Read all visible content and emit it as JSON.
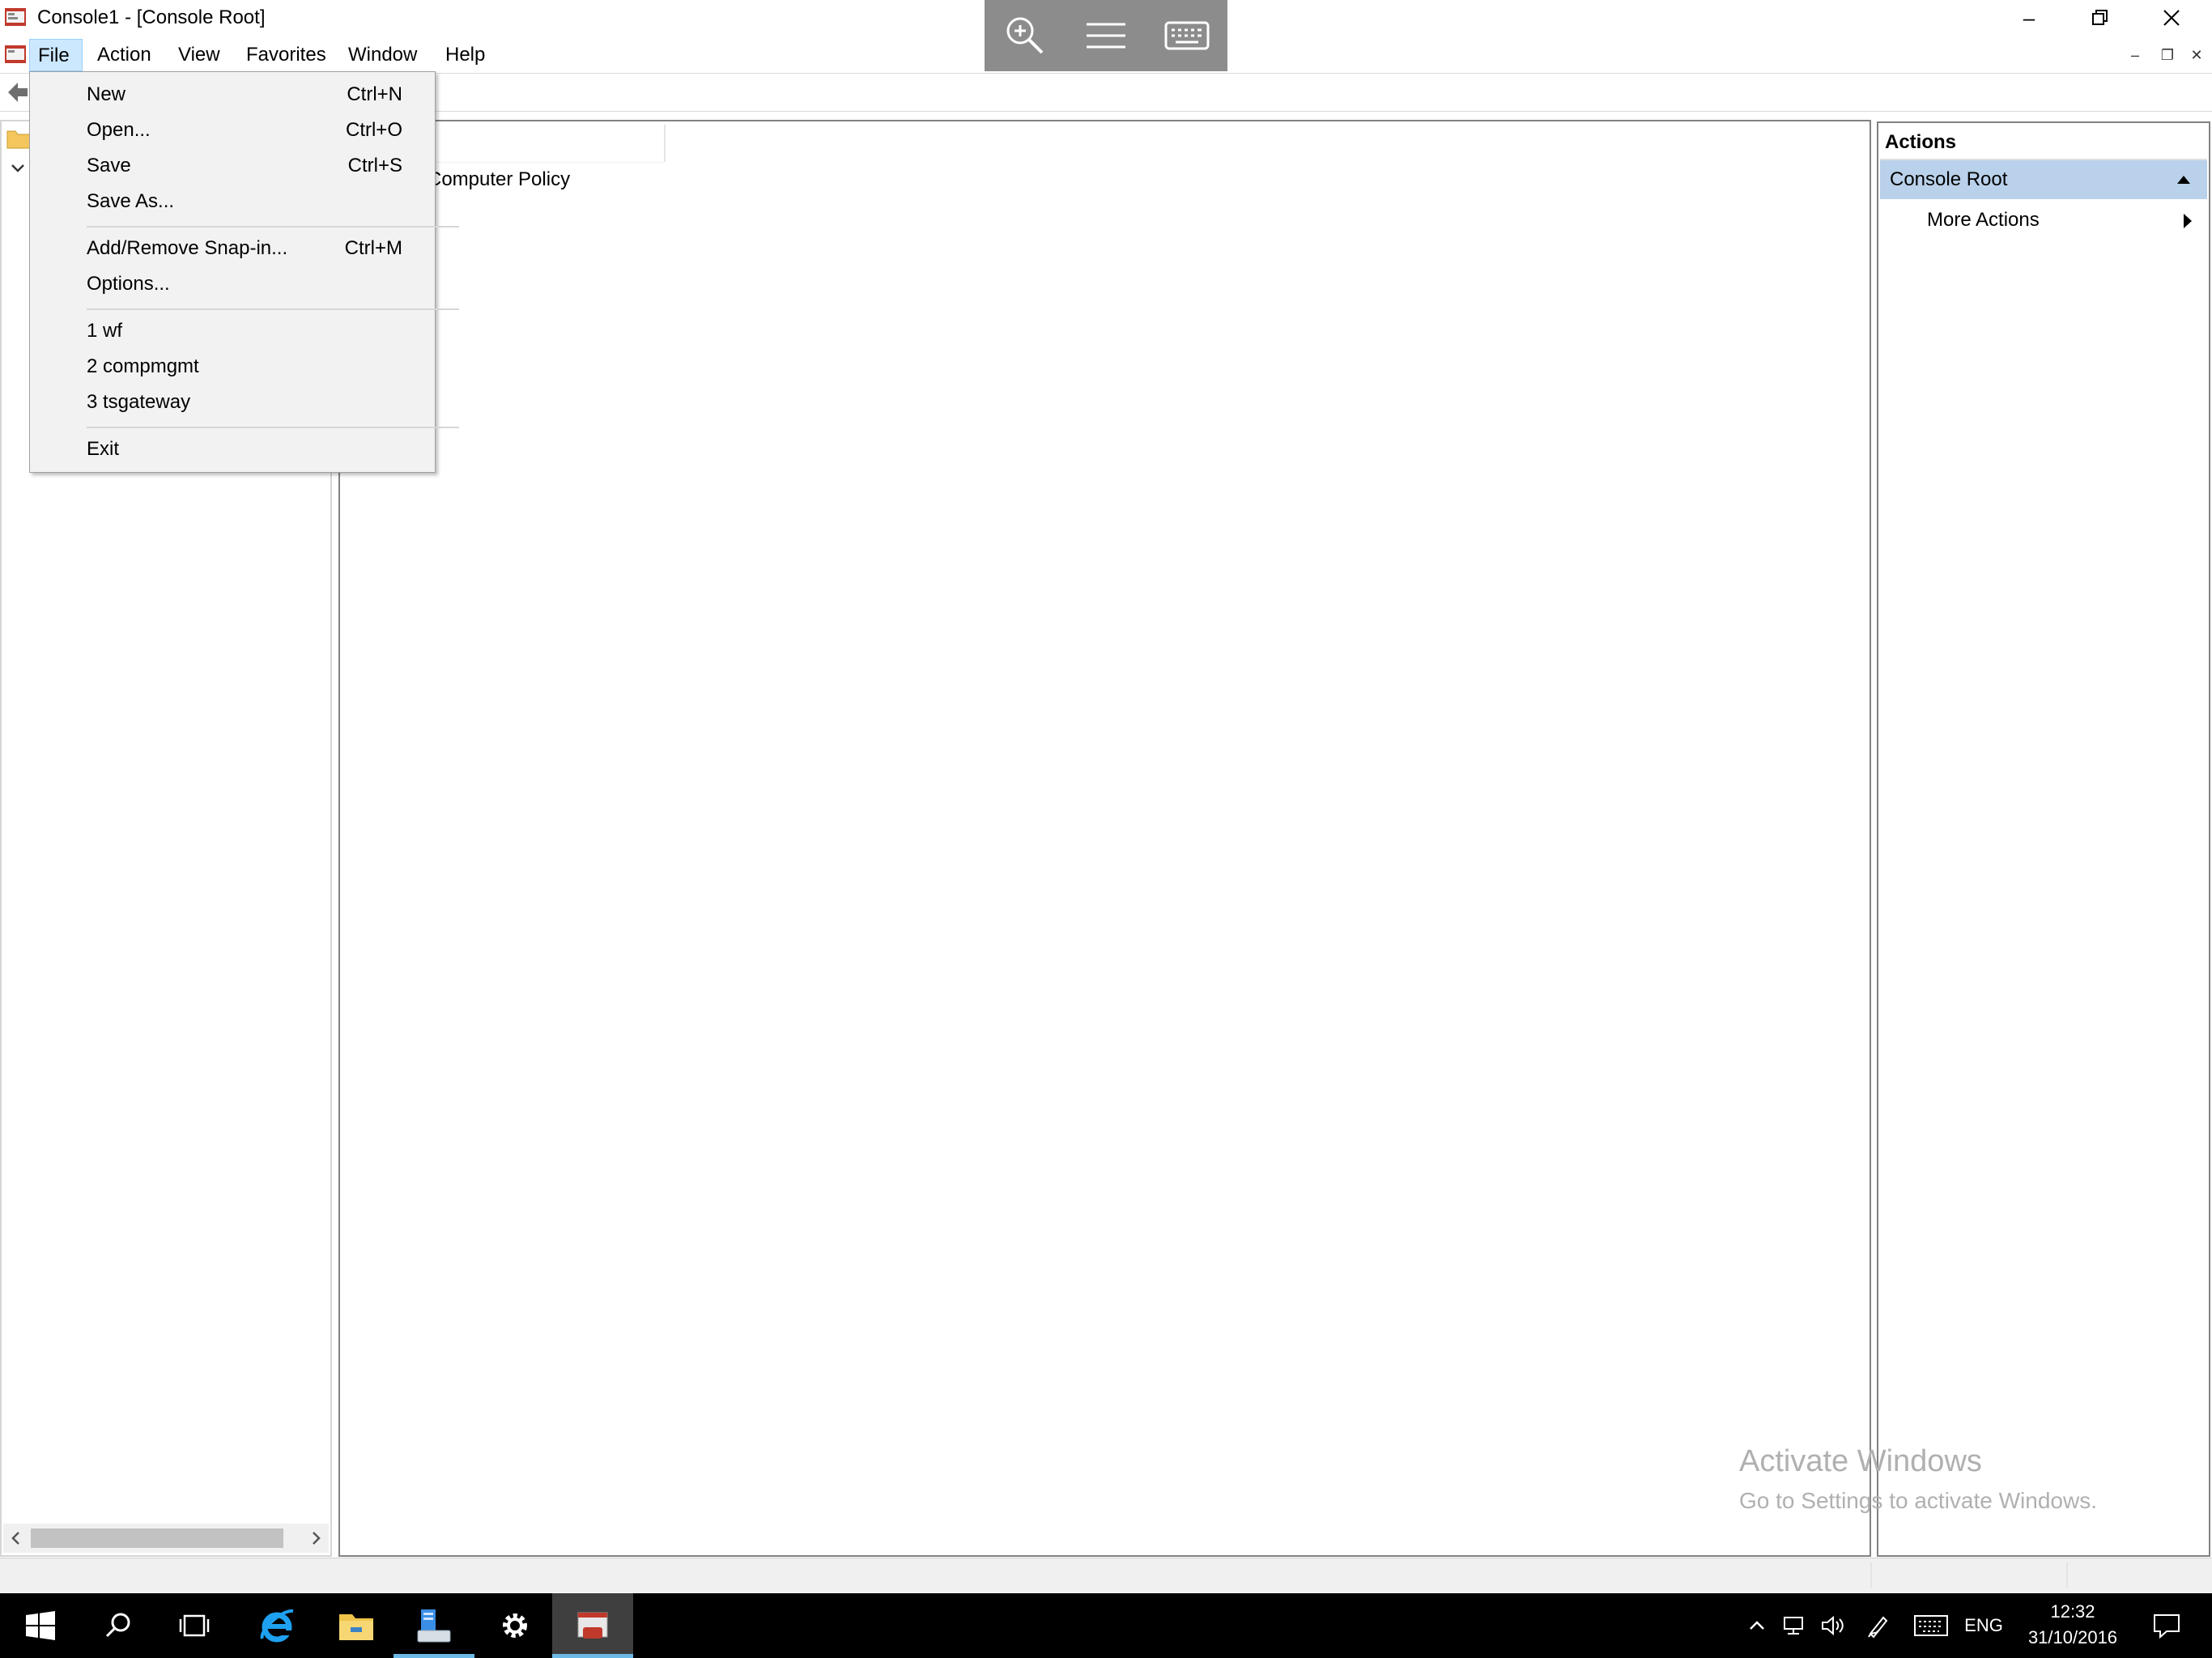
{
  "window": {
    "title": "Console1 - [Console Root]",
    "minimize_glyph": "–",
    "restore_glyph": "❐",
    "close_glyph": "✕"
  },
  "remote_toolbar": {
    "icons": [
      "zoom-icon",
      "menu-icon",
      "keyboard-icon"
    ]
  },
  "menubar": {
    "items": [
      "File",
      "Action",
      "View",
      "Favorites",
      "Window",
      "Help"
    ],
    "active": "File"
  },
  "file_menu": {
    "items": [
      {
        "label": "New",
        "shortcut": "Ctrl+N"
      },
      {
        "label": "Open...",
        "shortcut": "Ctrl+O"
      },
      {
        "label": "Save",
        "shortcut": "Ctrl+S"
      },
      {
        "label": "Save As...",
        "shortcut": ""
      },
      {
        "label": "Add/Remove Snap-in...",
        "shortcut": "Ctrl+M"
      },
      {
        "label": "Options...",
        "shortcut": ""
      },
      {
        "label": "1 wf",
        "shortcut": ""
      },
      {
        "label": "2 compmgmt",
        "shortcut": ""
      },
      {
        "label": "3 tsgateway",
        "shortcut": ""
      },
      {
        "label": "Exit",
        "shortcut": ""
      }
    ]
  },
  "center_pane": {
    "item": "Computer Policy"
  },
  "actions_pane": {
    "title": "Actions",
    "section": "Console Root",
    "more_actions": "More Actions"
  },
  "watermark": {
    "title": "Activate Windows",
    "subtitle": "Go to Settings to activate Windows."
  },
  "taskbar": {
    "icons": [
      "start-icon",
      "search-icon",
      "task-view-icon",
      "internet-explorer-icon",
      "file-explorer-icon",
      "server-manager-icon",
      "settings-icon",
      "mmc-icon"
    ],
    "language": "ENG",
    "time": "12:32",
    "date": "31/10/2016"
  },
  "colors": {
    "menu_highlight": "#cce8ff",
    "actions_section": "#b9d1ea",
    "taskbar": "#000000"
  }
}
